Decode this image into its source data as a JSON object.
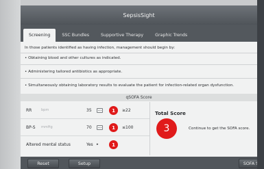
{
  "app": {
    "title": "SepsisSight"
  },
  "tabs": [
    {
      "label": "Screening",
      "active": true
    },
    {
      "label": "SSC Bundles",
      "active": false
    },
    {
      "label": "Supportive Therapy",
      "active": false
    },
    {
      "label": "Graphic Trends",
      "active": false
    }
  ],
  "intro": {
    "heading": "In those patients identified as having infection, management should begin by:",
    "bullets": [
      "•  Obtaining blood and other cultures as indicated.",
      "•  Administering tailored antibiotics as appropriate.",
      "•  Simultaneously obtaining laboratory results to evaluate the patient for infection-related organ dysfunction."
    ]
  },
  "qsofa": {
    "section_title": "qSOFA Score",
    "criteria": [
      {
        "name": "RR",
        "unit": "bpm",
        "value": "35",
        "points": "1",
        "threshold": "≥22",
        "control": "keyboard-icon"
      },
      {
        "name": "BP-S",
        "unit": "mmHg",
        "value": "70",
        "points": "1",
        "threshold": "≤100",
        "control": "keyboard-icon"
      },
      {
        "name": "Altered mental status",
        "unit": "",
        "value": "Yes",
        "points": "1",
        "threshold": "",
        "control": "dropdown-arrow-icon"
      }
    ],
    "total_title": "Total Score",
    "total_value": "3",
    "total_note": "Continue to get the SOFA score."
  },
  "footer": {
    "reset_label": "Reset",
    "setup_label": "Setup",
    "sofa_label": "SOFA S"
  },
  "colors": {
    "accent_red": "#e01a1a",
    "titlebar": "#5a5f64",
    "footer": "#51565b"
  }
}
